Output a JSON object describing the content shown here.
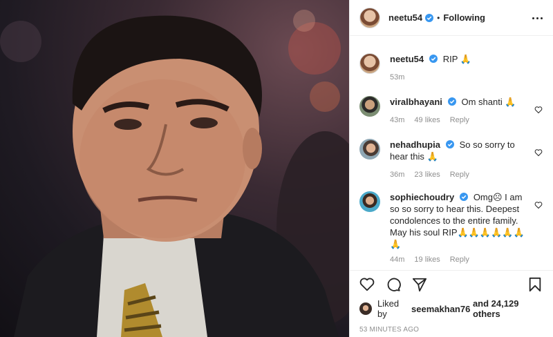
{
  "header": {
    "username": "neetu54",
    "separator": "•",
    "follow_status": "Following"
  },
  "comments": [
    {
      "username": "neetu54",
      "text": "RIP 🙏",
      "time": "53m",
      "likes": "",
      "reply": ""
    },
    {
      "username": "viralbhayani",
      "text": "Om shanti 🙏",
      "time": "43m",
      "likes": "49 likes",
      "reply": "Reply"
    },
    {
      "username": "nehadhupia",
      "text": "So so sorry to hear this 🙏",
      "time": "36m",
      "likes": "23 likes",
      "reply": "Reply"
    },
    {
      "username": "sophiechoudry",
      "text": "Omg☹ I am so so sorry to hear this. Deepest condolences to the entire family. May his soul RIP🙏🙏🙏🙏🙏🙏🙏",
      "time": "44m",
      "likes": "19 likes",
      "reply": "Reply"
    }
  ],
  "liked_by": {
    "prefix": "Liked by",
    "user": "seemakhan76",
    "suffix": "and 24,129 others"
  },
  "posted": "53 MINUTES AGO",
  "icons": {
    "like": "heart-icon",
    "comment": "comment-bubble-icon",
    "share": "paper-plane-icon",
    "save": "bookmark-icon",
    "more": "ellipsis-icon",
    "verified": "verified-badge-icon"
  },
  "colors": {
    "verified_blue": "#3897f0",
    "meta_gray": "#8e8e8e",
    "text": "#262626"
  }
}
